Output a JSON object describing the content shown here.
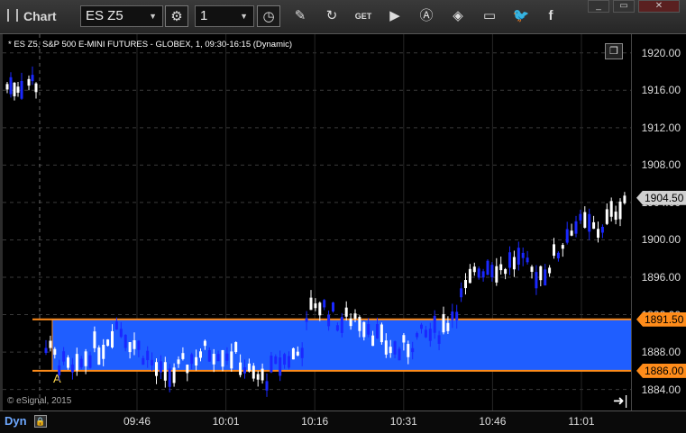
{
  "window": {
    "title": "Chart",
    "symbol_value": "ES Z5",
    "interval_value": "1",
    "buttons": [
      "min",
      "restore",
      "close"
    ]
  },
  "toolbar": {
    "icons": [
      "settings-icon",
      "clock-icon",
      "pencil-icon",
      "refresh-icon",
      "get-icon",
      "play-icon",
      "alert-icon",
      "tag-icon",
      "comment-icon",
      "twitter-icon",
      "facebook-icon"
    ],
    "get_label": "GET"
  },
  "chart": {
    "description": "* ES Z5, S&P 500 E-MINI FUTURES - GLOBEX, 1, 09:30-16:15 (Dynamic)",
    "copyright": "© eSignal, 2015",
    "marker_label": "A",
    "time_mode": "Dyn"
  },
  "colors": {
    "background": "#000000",
    "band": "#1f5eff",
    "band_line": "#ff8c1a",
    "up_candle": "#ffffff",
    "down_candle": "#1a28ff",
    "last_price_badge": "#d0d0d0"
  },
  "chart_data": {
    "type": "candlestick",
    "y_ticks": [
      "1920.00",
      "1916.00",
      "1912.00",
      "1908.00",
      "1904.00",
      "1900.00",
      "1896.00",
      "1892.00",
      "1888.00",
      "1884.00"
    ],
    "x_ticks": [
      "09:46",
      "10:01",
      "10:16",
      "10:31",
      "10:46",
      "11:01"
    ],
    "ylim": [
      1881.75,
      1922.0
    ],
    "last_price": "1904.50",
    "band_upper": "1891.50",
    "band_lower": "1886.00",
    "grid": true
  }
}
